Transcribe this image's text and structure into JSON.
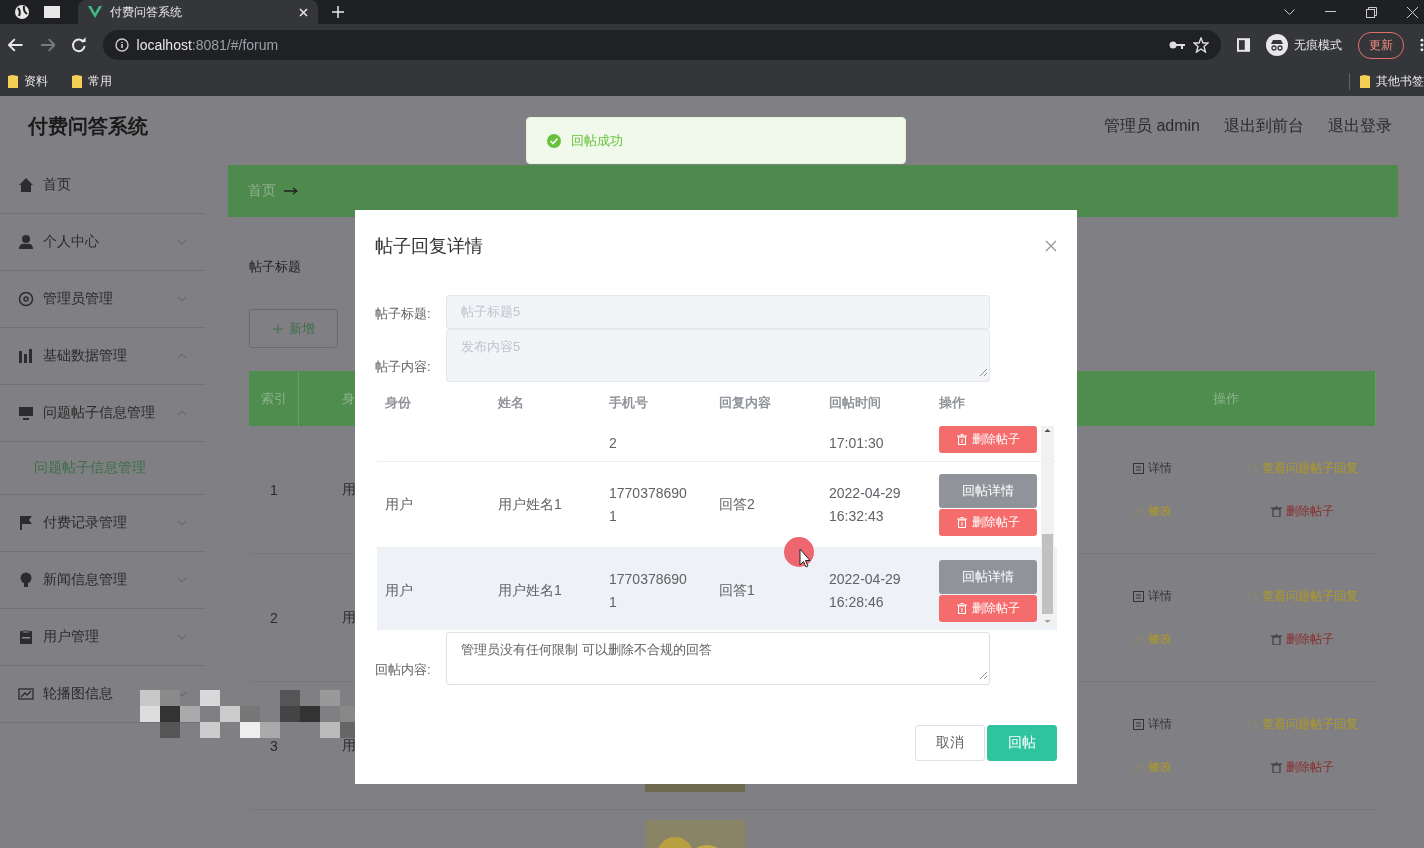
{
  "browser": {
    "tab": {
      "title": "付费问答系统",
      "selected": true
    },
    "url": {
      "host": "localhost",
      "path": ":8081/#/forum"
    },
    "profile": "无痕模式",
    "update_button": "更新",
    "bookmarks": [
      "资料",
      "常用"
    ],
    "other_bookmarks": "其他书签"
  },
  "app_title": "付费问答系统",
  "header_links": [
    "管理员 admin",
    "退出到前台",
    "退出登录"
  ],
  "sidebar": {
    "items": [
      {
        "label": "首页",
        "kind": "link"
      },
      {
        "label": "个人中心",
        "kind": "submenu",
        "expanded": false
      },
      {
        "label": "管理员管理",
        "kind": "submenu",
        "expanded": false
      },
      {
        "label": "基础数据管理",
        "kind": "submenu",
        "expanded": true
      },
      {
        "label": "问题帖子信息管理",
        "kind": "submenu",
        "expanded": true,
        "children": [
          {
            "label": "问题帖子信息管理",
            "selected": true
          }
        ]
      },
      {
        "label": "付费记录管理",
        "kind": "submenu",
        "expanded": false
      },
      {
        "label": "新闻信息管理",
        "kind": "submenu",
        "expanded": false
      },
      {
        "label": "用户管理",
        "kind": "submenu",
        "expanded": false
      },
      {
        "label": "轮播图信息",
        "kind": "submenu",
        "expanded": false
      }
    ]
  },
  "breadcrumb": [
    "首页"
  ],
  "search": {
    "label": "帖子标题"
  },
  "add_button": "新增",
  "table": {
    "columns": [
      "索引",
      "身",
      "操作"
    ],
    "rows": [
      {
        "index": "1",
        "column_2": "用",
        "actions": [
          {
            "label": "详情",
            "kind": "detail"
          },
          {
            "label": "查看问题帖子回复",
            "kind": "view"
          },
          {
            "label": "修改",
            "kind": "edit"
          },
          {
            "label": "删除帖子",
            "kind": "delete"
          }
        ]
      },
      {
        "index": "2",
        "column_2": "用",
        "actions": [
          {
            "label": "详情",
            "kind": "detail"
          },
          {
            "label": "查看问题帖子回复",
            "kind": "view"
          },
          {
            "label": "修改",
            "kind": "edit"
          },
          {
            "label": "删除帖子",
            "kind": "delete"
          }
        ]
      },
      {
        "index": "3",
        "column_2": "用",
        "cover": {
          "kind": "picture"
        },
        "actions": [
          {
            "label": "详情",
            "kind": "detail"
          },
          {
            "label": "查看问题帖子回复",
            "kind": "view"
          },
          {
            "label": "修改",
            "kind": "edit"
          },
          {
            "label": "删除帖子",
            "kind": "delete"
          }
        ]
      },
      {
        "cover": {
          "kind": "picture"
        }
      }
    ]
  },
  "toast": {
    "kind": "success",
    "message": "回帖成功"
  },
  "dialog": {
    "title": "帖子回复详情",
    "fields": [
      {
        "label": "帖子标题:",
        "kind": "input",
        "placeholder": "帖子标题5",
        "disabled": true
      },
      {
        "label": "帖子内容:",
        "kind": "textarea",
        "placeholder": "发布内容5",
        "disabled": true
      }
    ],
    "reply_table": {
      "columns": [
        "身份",
        "姓名",
        "手机号",
        "回复内容",
        "回帖时间",
        "操作"
      ],
      "rows": [
        {
          "phone": "2",
          "time": "17:01:30",
          "highlighted": false,
          "actions": [
            {
              "label": "删除帖子",
              "kind": "delete"
            }
          ]
        },
        {
          "identity": "用户",
          "name": "用户姓名1",
          "phone": "17703786901",
          "reply": "回答2",
          "time": "2022-04-29 16:32:43",
          "highlighted": false,
          "actions": [
            {
              "label": "回帖详情",
              "kind": "detail"
            },
            {
              "label": "删除帖子",
              "kind": "delete"
            }
          ]
        },
        {
          "identity": "用户",
          "name": "用户姓名1",
          "phone": "17703786901",
          "reply": "回答1",
          "time": "2022-04-29 16:28:46",
          "highlighted": true,
          "actions": [
            {
              "label": "回帖详情",
              "kind": "detail"
            },
            {
              "label": "删除帖子",
              "kind": "delete"
            }
          ]
        }
      ]
    },
    "reply_field": {
      "label": "回帖内容:",
      "value": "管理员没有任何限制  可以删除不合规的回答"
    },
    "buttons": [
      {
        "label": "取消",
        "kind": "default"
      },
      {
        "label": "回帖",
        "kind": "primary"
      }
    ]
  }
}
